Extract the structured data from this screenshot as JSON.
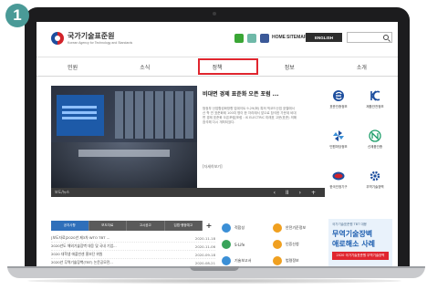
{
  "step_number": "1",
  "header": {
    "logo_title": "국가기술표준원",
    "logo_subtitle": "Korean Agency for Technology and Standards",
    "links": [
      "HOME",
      "SITEMAP"
    ],
    "english_button": "ENGLISH",
    "search_placeholder": ""
  },
  "nav": {
    "items": [
      "민원",
      "소식",
      "정책",
      "정보",
      "소개"
    ],
    "highlighted": "정책",
    "highlight_color": "#e0262f"
  },
  "hero": {
    "title": "비대면 경제 표준화 오픈 포럼 ...",
    "body": "범정부 산업활성화방향 업데이트 9.29(화) 특허 빅코드산업 호텔에서 산 학 연 표준화제 100여 명이 한 자리에서 앞으로 참석한 가운데 비대면 경제 표준화 오픈포럼[포럼 : IS ELECTRIC 미래표 고문(표준) 의해 참석해 다시 개최되었다.",
    "more": "[자세히보기]",
    "caption": "보도/뉴스",
    "controls": [
      "‹",
      "II",
      "›",
      "+"
    ]
  },
  "quick_links": [
    {
      "label": "표준인증정보",
      "icon": "e-logo-icon"
    },
    {
      "label": "제품안전정보",
      "icon": "kc-mark-icon"
    },
    {
      "label": "민원마당정보",
      "icon": "pinwheel-icon"
    },
    {
      "label": "신제품인증",
      "icon": "nep-mark-icon"
    },
    {
      "label": "한국인정기구",
      "icon": "kolas-oval-icon"
    },
    {
      "label": "무역기술장벽",
      "icon": "gear-icon"
    }
  ],
  "tabs": [
    "공지사항",
    "보도자료",
    "고시공고",
    "입법·행정예고"
  ],
  "tab_plus": "+",
  "news": [
    {
      "title": "[보도자료]2020년 제3차 WTO TBT ...",
      "date": "2020-11-18"
    },
    {
      "title": "2020년도 해외기술장벽 대응 및 국내 기업...",
      "date": "2020-11-06"
    },
    {
      "title": "2020 대학생 애플빈센 홍보단 위원",
      "date": "2020-09-18"
    },
    {
      "title": "2020년 무역기술장벽(TBT) 논문공모전...",
      "date": "2020-08-21"
    }
  ],
  "services": [
    {
      "label": "적합성",
      "color": "#3b8fd6"
    },
    {
      "label": "안전기준정보",
      "color": "#f0a020"
    },
    {
      "label": "S-Life",
      "color": "#39a35a"
    },
    {
      "label": "인증신청",
      "color": "#f0a020"
    },
    {
      "label": "기술보고서",
      "color": "#3b8fd6"
    },
    {
      "label": "법령정보",
      "color": "#f0a020"
    }
  ],
  "banner": {
    "small": "국가기술표준원 TBT 대응",
    "line1": "무역기술장벽",
    "line2": "애로해소 사례",
    "strip": "2020 국가기술표준원 무역기술장벽"
  }
}
